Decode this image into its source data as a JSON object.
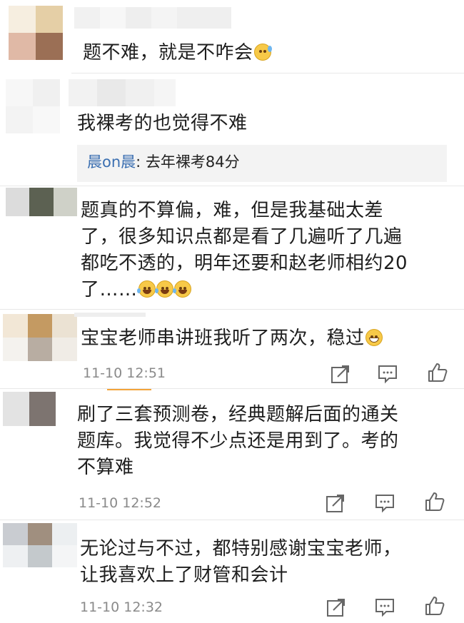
{
  "comments": [
    {
      "text": "题不难，就是不咋会",
      "emoji": "sweat-smile-icon"
    },
    {
      "text": "我裸考的也觉得不难",
      "reply": {
        "name": "晨on晨",
        "sep": ": ",
        "text": "去年裸考84分"
      }
    },
    {
      "lines": [
        "题真的不算偏，难，但是我基础太差",
        "了，很多知识点都是看了几遍听了几遍",
        "都吃不透的，明年还要和赵老师相约20",
        "了……"
      ],
      "emoji": "laugh-cry-icon"
    },
    {
      "text": "宝宝老师串讲班我听了两次，稳过",
      "emoji": "grin-icon",
      "time": "11-10 12:51"
    },
    {
      "lines": [
        "刷了三套预测卷，经典题解后面的通关",
        "题库。我觉得不少点还是用到了。考的",
        "不算难"
      ],
      "time": "11-10 12:52"
    },
    {
      "lines": [
        "无论过与不过，都特别感谢宝宝老师，",
        "让我喜欢上了财管和会计"
      ],
      "time": "11-10 12:32"
    }
  ],
  "actions": {
    "share_icon": "share-icon",
    "comment_icon": "comment-icon",
    "like_icon": "thumbs-up-icon"
  },
  "colors": {
    "reply_name": "#3b6fb1",
    "time": "#8a8a8a",
    "tab_underline": "#f3a43a",
    "reply_bg": "#f3f3f3"
  }
}
